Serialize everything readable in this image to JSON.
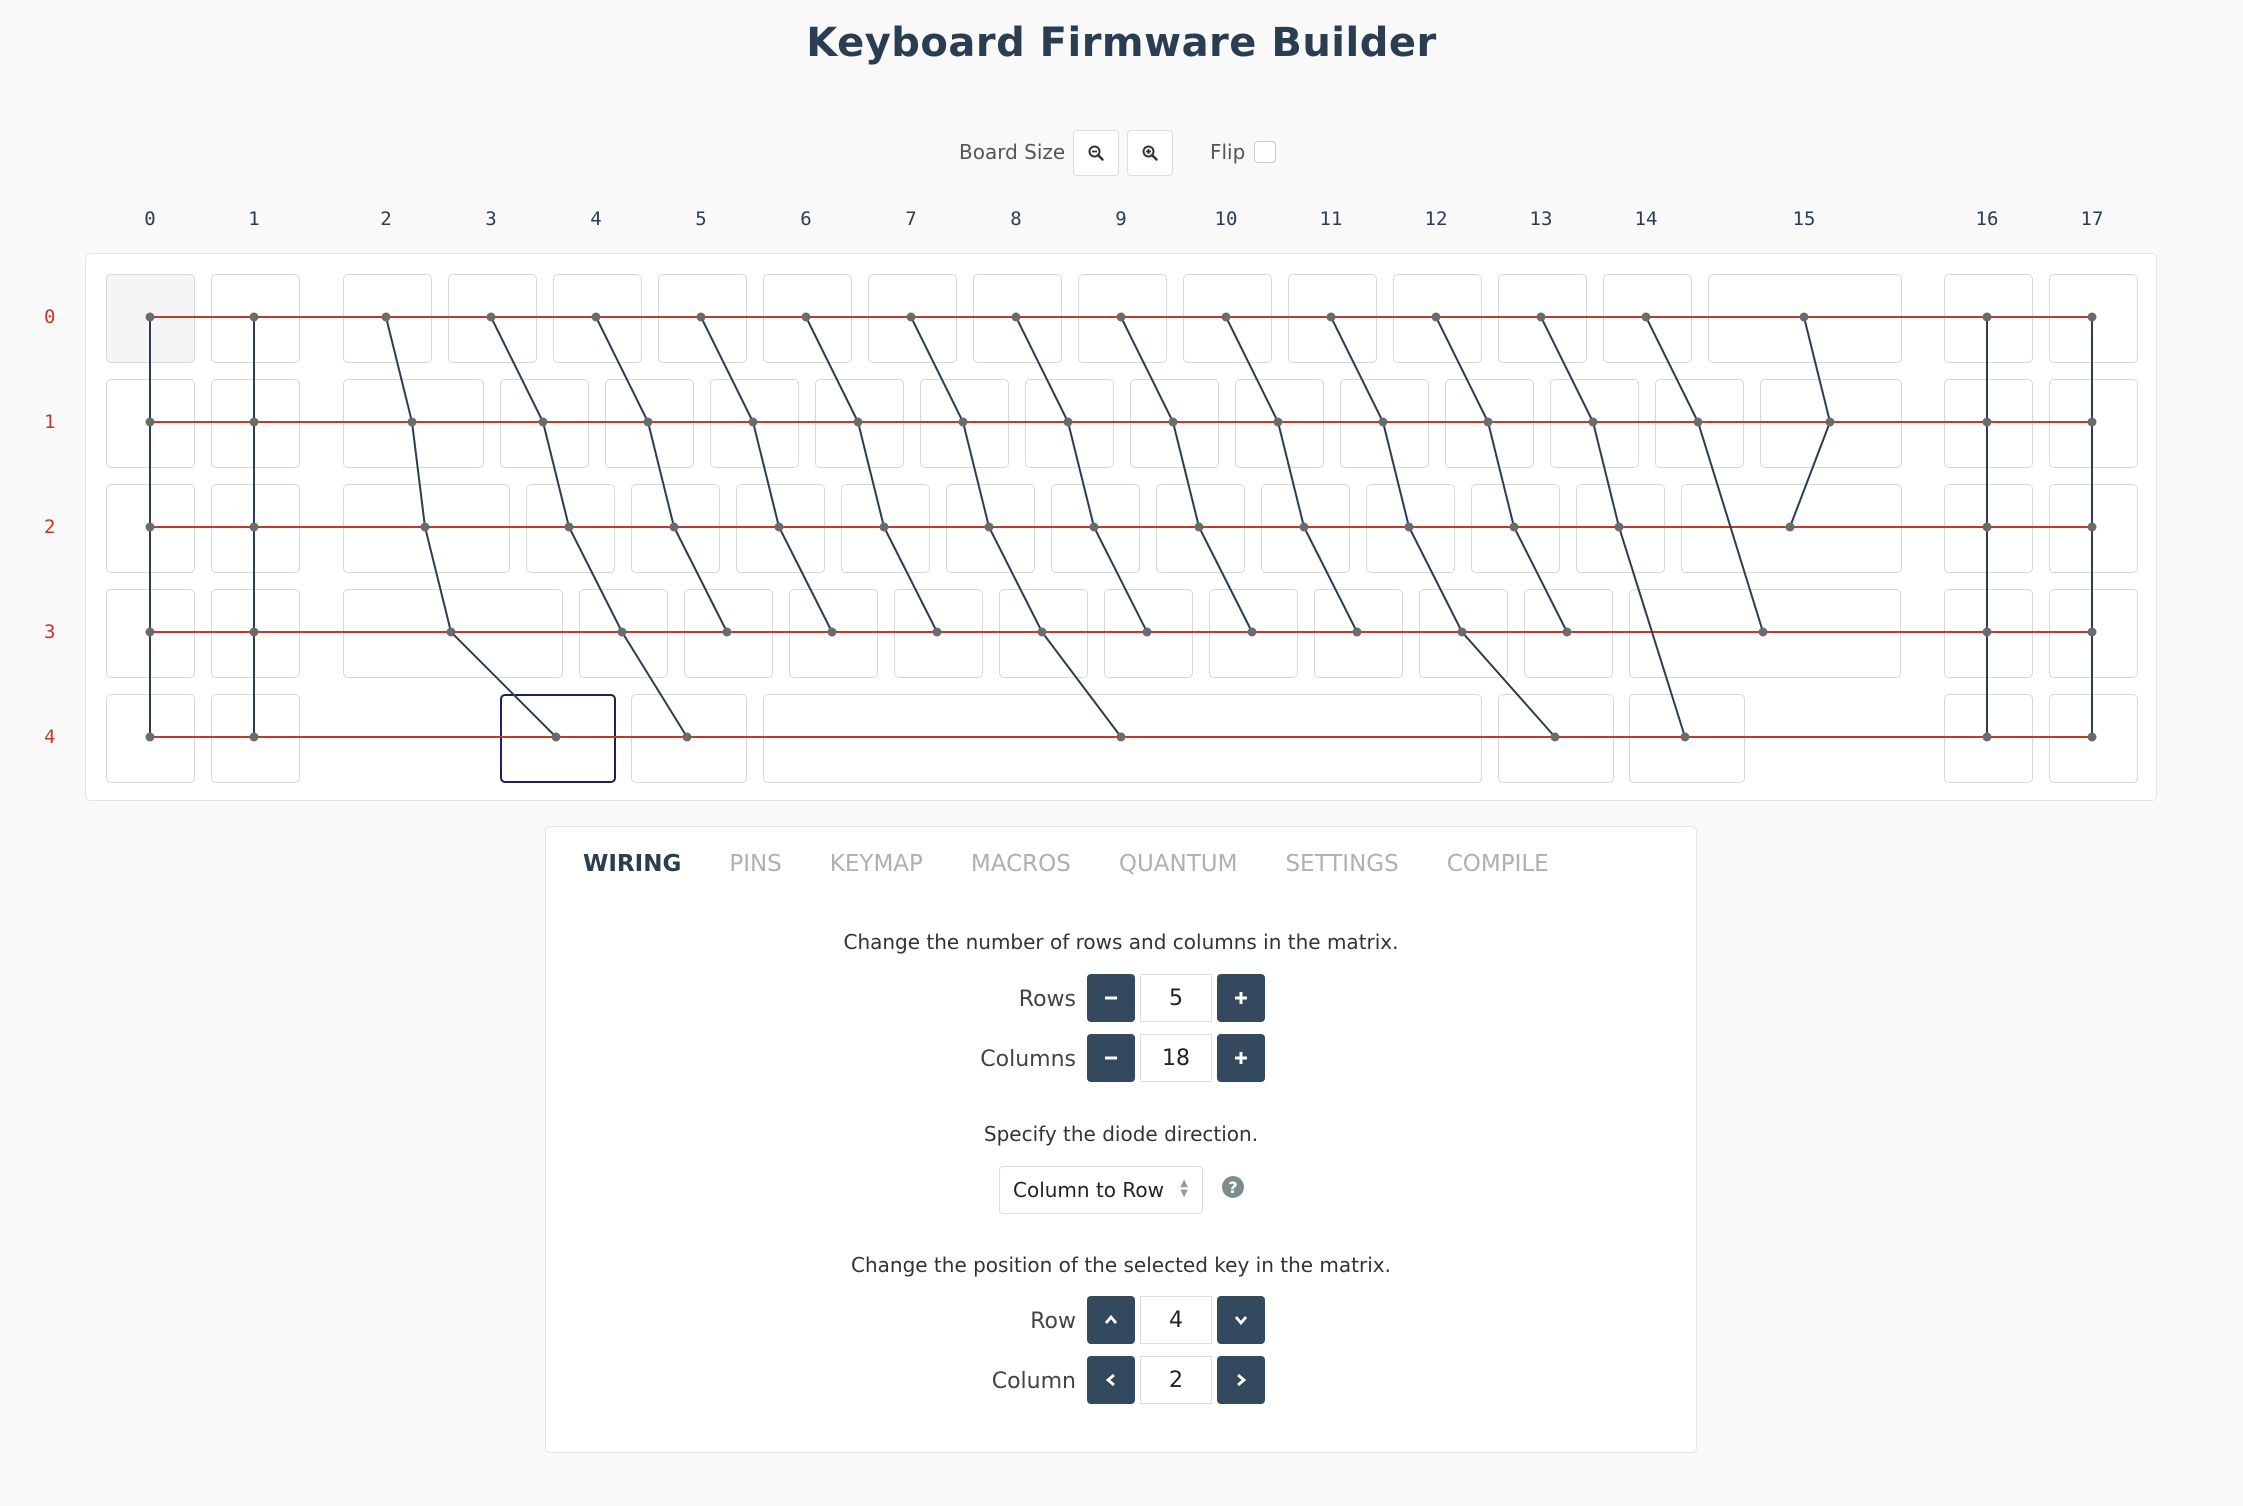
{
  "title": "Keyboard Firmware Builder",
  "toolbar": {
    "board_size_label": "Board Size",
    "zoom_out_icon": "zoom-out-icon",
    "zoom_in_icon": "zoom-in-icon",
    "flip_label": "Flip",
    "flip_checked": false
  },
  "matrix": {
    "column_labels": [
      "0",
      "1",
      "2",
      "3",
      "4",
      "5",
      "6",
      "7",
      "8",
      "9",
      "10",
      "11",
      "12",
      "13",
      "14",
      "15",
      "16",
      "17"
    ],
    "row_labels": [
      "0",
      "1",
      "2",
      "3",
      "4"
    ]
  },
  "colors": {
    "row_wire": "#c0392b",
    "column_wire": "#2b3d51",
    "accent": "#34495e"
  },
  "tabs": [
    {
      "label": "WIRING",
      "active": true
    },
    {
      "label": "PINS",
      "active": false
    },
    {
      "label": "KEYMAP",
      "active": false
    },
    {
      "label": "MACROS",
      "active": false
    },
    {
      "label": "QUANTUM",
      "active": false
    },
    {
      "label": "SETTINGS",
      "active": false
    },
    {
      "label": "COMPILE",
      "active": false
    }
  ],
  "wiring": {
    "matrix_desc": "Change the number of rows and columns in the matrix.",
    "rows_label": "Rows",
    "rows_value": "5",
    "columns_label": "Columns",
    "columns_value": "18",
    "diode_desc": "Specify the diode direction.",
    "diode_value": "Column to Row",
    "position_desc": "Change the position of the selected key in the matrix.",
    "row_label": "Row",
    "row_value": "4",
    "column_label": "Column",
    "column_value": "2"
  }
}
